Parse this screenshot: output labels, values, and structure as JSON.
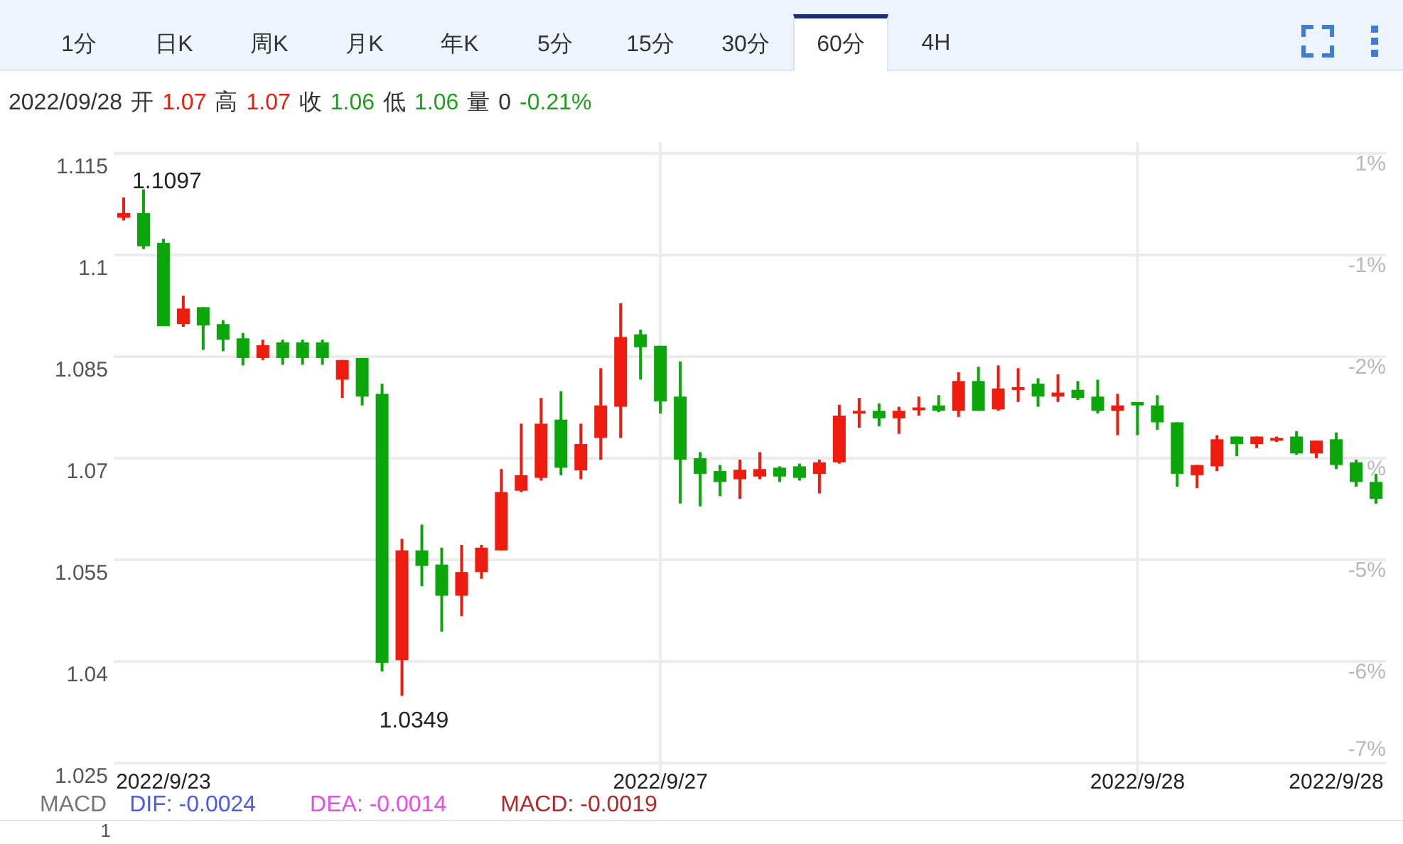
{
  "tabs": [
    {
      "label": "1分",
      "selected": false
    },
    {
      "label": "日K",
      "selected": false
    },
    {
      "label": "周K",
      "selected": false
    },
    {
      "label": "月K",
      "selected": false
    },
    {
      "label": "年K",
      "selected": false
    },
    {
      "label": "5分",
      "selected": false
    },
    {
      "label": "15分",
      "selected": false
    },
    {
      "label": "30分",
      "selected": false
    },
    {
      "label": "60分",
      "selected": true
    },
    {
      "label": "4H",
      "selected": false
    }
  ],
  "quote": {
    "date": "2022/09/28",
    "volume_label": "量",
    "volume": "0",
    "change": {
      "text": "-0.21%",
      "color": "#1aa11a"
    },
    "items": [
      {
        "label": "开",
        "value": "1.07",
        "color": "#ee1c0f"
      },
      {
        "label": "高",
        "value": "1.07",
        "color": "#ee1c0f"
      },
      {
        "label": "收",
        "value": "1.06",
        "color": "#1aa11a"
      },
      {
        "label": "低",
        "value": "1.06",
        "color": "#1aa11a"
      }
    ]
  },
  "chart": {
    "percent_ticks": [
      "1%",
      "-1%",
      "-2%",
      "%",
      "-5%",
      "-6%",
      "-7%"
    ],
    "high_label": "1.1097",
    "low_label": "1.0349",
    "chart_data": {
      "type": "candlestick",
      "ylim": [
        1.025,
        1.115
      ],
      "grid": true,
      "categories": [
        null,
        null,
        "2022/9/23",
        null,
        null,
        null,
        null,
        null,
        null,
        null,
        null,
        null,
        null,
        null,
        null,
        null,
        null,
        null,
        null,
        null,
        null,
        null,
        null,
        null,
        null,
        null,
        null,
        "2022/9/27",
        null,
        null,
        null,
        null,
        null,
        null,
        null,
        null,
        null,
        null,
        null,
        null,
        null,
        null,
        null,
        null,
        null,
        null,
        null,
        null,
        null,
        null,
        null,
        "2022/9/28",
        null,
        null,
        null,
        null,
        null,
        null,
        null,
        null,
        null,
        "2022/9/28",
        null,
        null
      ],
      "yticks": [
        {
          "value": 1.115,
          "label": "1.115"
        },
        {
          "value": 1.1,
          "label": "1.1"
        },
        {
          "value": 1.085,
          "label": "1.085"
        },
        {
          "value": 1.07,
          "label": "1.07"
        },
        {
          "value": 1.055,
          "label": "1.055"
        },
        {
          "value": 1.04,
          "label": "1.04"
        },
        {
          "value": 1.025,
          "label": "1.025"
        }
      ],
      "ohlc": [
        [
          1.1055,
          1.1085,
          1.1051,
          1.1062
        ],
        [
          1.1062,
          1.1097,
          1.1009,
          1.1013
        ],
        [
          1.1018,
          1.1024,
          1.0895,
          1.0895
        ],
        [
          1.0898,
          1.094,
          1.0894,
          1.0921
        ],
        [
          1.0923,
          1.0923,
          1.086,
          1.0896
        ],
        [
          1.0898,
          1.0904,
          1.0858,
          1.0875
        ],
        [
          1.0877,
          1.0885,
          1.0837,
          1.0848
        ],
        [
          1.0848,
          1.0875,
          1.0845,
          1.0867
        ],
        [
          1.0871,
          1.0875,
          1.0838,
          1.0848
        ],
        [
          1.0871,
          1.0875,
          1.0838,
          1.0848
        ],
        [
          1.0871,
          1.0875,
          1.0838,
          1.0848
        ],
        [
          1.0816,
          1.0845,
          1.0789,
          1.0845
        ],
        [
          1.0848,
          1.0848,
          1.0778,
          1.0791
        ],
        [
          1.0795,
          1.081,
          1.0385,
          1.0398
        ],
        [
          1.0402,
          1.0581,
          1.0349,
          1.0564
        ],
        [
          1.0564,
          1.0602,
          1.0511,
          1.0541
        ],
        [
          1.0543,
          1.0568,
          1.0444,
          1.0497
        ],
        [
          1.0497,
          1.0572,
          1.0467,
          1.0532
        ],
        [
          1.0532,
          1.0572,
          1.0522,
          1.0568
        ],
        [
          1.0564,
          1.0684,
          1.0564,
          1.065
        ],
        [
          1.0652,
          1.0751,
          1.065,
          1.0675
        ],
        [
          1.0671,
          1.0789,
          1.0667,
          1.0751
        ],
        [
          1.0757,
          1.0799,
          1.0675,
          1.0686
        ],
        [
          1.0682,
          1.0751,
          1.0669,
          1.0721
        ],
        [
          1.073,
          1.0833,
          1.0698,
          1.0778
        ],
        [
          1.0776,
          1.0929,
          1.073,
          1.0879
        ],
        [
          1.0883,
          1.089,
          1.0816,
          1.0864
        ],
        [
          1.0866,
          1.0866,
          1.0766,
          1.0784
        ],
        [
          1.0791,
          1.0843,
          1.0633,
          1.0698
        ],
        [
          1.07,
          1.0709,
          1.0629,
          1.0677
        ],
        [
          1.0681,
          1.069,
          1.0644,
          1.0665
        ],
        [
          1.0669,
          1.0698,
          1.064,
          1.0683
        ],
        [
          1.0673,
          1.0709,
          1.0669,
          1.0684
        ],
        [
          1.0686,
          1.0688,
          1.0665,
          1.0673
        ],
        [
          1.0688,
          1.0692,
          1.0667,
          1.0671
        ],
        [
          1.0677,
          1.0698,
          1.0648,
          1.0694
        ],
        [
          1.0694,
          1.0779,
          1.0692,
          1.0763
        ],
        [
          1.0768,
          1.0789,
          1.0745,
          1.077
        ],
        [
          1.077,
          1.0781,
          1.0747,
          1.0759
        ],
        [
          1.0759,
          1.0776,
          1.0736,
          1.077
        ],
        [
          1.0773,
          1.0791,
          1.0763,
          1.0775
        ],
        [
          1.0778,
          1.0793,
          1.0768,
          1.077
        ],
        [
          1.077,
          1.0827,
          1.0761,
          1.0814
        ],
        [
          1.0814,
          1.0835,
          1.077,
          1.077
        ],
        [
          1.0772,
          1.0837,
          1.077,
          1.0803
        ],
        [
          1.0803,
          1.0833,
          1.0783,
          1.0805
        ],
        [
          1.081,
          1.0818,
          1.0776,
          1.0791
        ],
        [
          1.0791,
          1.0824,
          1.0783,
          1.0797
        ],
        [
          1.0801,
          1.0814,
          1.0786,
          1.0789
        ],
        [
          1.0791,
          1.0816,
          1.0766,
          1.077
        ],
        [
          1.077,
          1.0795,
          1.0734,
          1.0778
        ],
        [
          1.0783,
          1.0783,
          1.0734,
          1.0778
        ],
        [
          1.0778,
          1.0793,
          1.0742,
          1.0753
        ],
        [
          1.0753,
          1.0753,
          1.0658,
          1.0677
        ],
        [
          1.0675,
          1.069,
          1.0656,
          1.069
        ],
        [
          1.0688,
          1.0734,
          1.0681,
          1.0728
        ],
        [
          1.0732,
          1.0732,
          1.0703,
          1.0721
        ],
        [
          1.0721,
          1.0732,
          1.0715,
          1.0732
        ],
        [
          1.0728,
          1.0732,
          1.0724,
          1.073
        ],
        [
          1.0732,
          1.074,
          1.0705,
          1.0707
        ],
        [
          1.0707,
          1.0726,
          1.07,
          1.0726
        ],
        [
          1.0728,
          1.0738,
          1.0684,
          1.069
        ],
        [
          1.0694,
          1.0698,
          1.0658,
          1.0665
        ],
        [
          1.0665,
          1.0677,
          1.0633,
          1.064
        ]
      ]
    }
  },
  "macd": {
    "title": "MACD",
    "values": [
      {
        "label": "DIF: -0.0024",
        "color": "#4a5cf0"
      },
      {
        "label": "DEA: -0.0014",
        "color": "#e64de6"
      },
      {
        "label": "MACD: -0.0019",
        "color": "#b02a2a"
      }
    ],
    "axis_label": "1"
  }
}
